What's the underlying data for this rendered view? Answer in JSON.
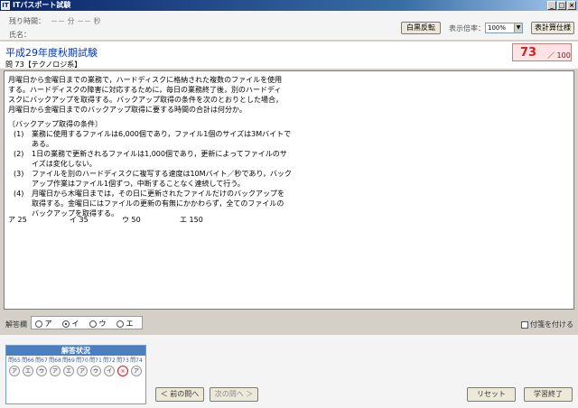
{
  "window": {
    "title": "ITパスポート試験",
    "icon_text": "IT",
    "minimize": "_",
    "maximize": "□",
    "close": "×"
  },
  "header": {
    "time_label": "残り時間：",
    "time_value": "－－ 分 －－ 秒",
    "name_label": "氏名：",
    "invert_button": "白黒反転",
    "zoom_label": "表示倍率：",
    "zoom_value": "100%",
    "calc_button": "表計算仕様"
  },
  "exam": {
    "title": "平成29年度秋期試験",
    "question_no": "問 73【テクノロジ系】",
    "score": "73",
    "score_total": "／ 100"
  },
  "question": {
    "lines": [
      "月曜日から金曜日までの業務で，ハードディスクに格納された複数のファイルを使用",
      "する。ハードディスクの障害に対応するために，毎日の業務終了後，別のハードディ",
      "スクにバックアップを取得する。バックアップ取得の条件を次のとおりとした場合，",
      "月曜日から金曜日までのバックアップ取得に要する時間の合計は何分か。"
    ],
    "conditions_title": "〔バックアップ取得の条件〕",
    "conditions": [
      {
        "no": "(1)",
        "lines": [
          "業務に使用するファイルは6,000個であり，ファイル1個のサイズは3Mバイトで",
          "ある。"
        ]
      },
      {
        "no": "(2)",
        "lines": [
          "1日の業務で更新されるファイルは1,000個であり，更新によってファイルのサ",
          "イズは変化しない。"
        ]
      },
      {
        "no": "(3)",
        "lines": [
          "ファイルを別のハードディスクに複写する速度は10Mバイト／秒であり，バック",
          "アップ作業はファイル1個ずつ，中断することなく連続して行う。"
        ]
      },
      {
        "no": "(4)",
        "lines": [
          "月曜日から木曜日までは，その日に更新されたファイルだけのバックアップを",
          "取得する。金曜日にはファイルの更新の有無にかかわらず，全てのファイルの",
          "バックアップを取得する。"
        ]
      }
    ],
    "choices": [
      {
        "label": "ア",
        "value": "25"
      },
      {
        "label": "イ",
        "value": "35"
      },
      {
        "label": "ウ",
        "value": "50"
      },
      {
        "label": "エ",
        "value": "150"
      }
    ]
  },
  "answer": {
    "label": "解答欄",
    "options": [
      "ア",
      "イ",
      "ウ",
      "エ"
    ],
    "selected": "イ",
    "bookmark_label": "付箋を付ける"
  },
  "status": {
    "title": "解答状況",
    "items": [
      {
        "label": "問65",
        "mark": "ア"
      },
      {
        "label": "問66",
        "mark": "エ"
      },
      {
        "label": "問67",
        "mark": "ウ"
      },
      {
        "label": "問68",
        "mark": "ア"
      },
      {
        "label": "問69",
        "mark": "エ"
      },
      {
        "label": "問70",
        "mark": "ア"
      },
      {
        "label": "問71",
        "mark": "ウ"
      },
      {
        "label": "問72",
        "mark": "イ"
      },
      {
        "label": "問73",
        "mark": "×"
      },
      {
        "label": "問74",
        "mark": "ア"
      }
    ]
  },
  "nav": {
    "prev": "＜ 前の問へ",
    "next": "次の問へ ＞",
    "reset": "リセット",
    "finish": "学習終了"
  }
}
